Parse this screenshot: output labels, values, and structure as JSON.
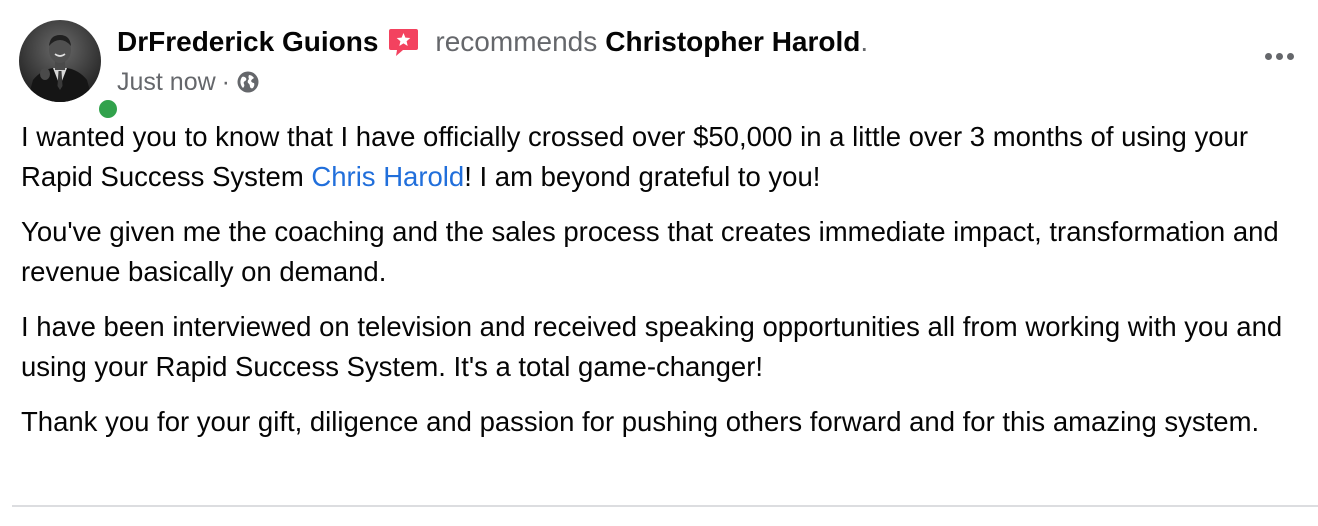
{
  "post": {
    "author": "DrFrederick Guions",
    "verb": "recommends",
    "target": "Christopher Harold",
    "period": ".",
    "timestamp": "Just now",
    "meta_separator": "·",
    "visibility_icon": "globe-icon",
    "recommend_icon": "recommend-badge-icon",
    "more_icon": "more-options-icon",
    "online": true,
    "paragraphs": [
      {
        "before": "I wanted you to know that I have officially crossed over $50,000 in a little over 3 months of using your Rapid Success System ",
        "mention": "Chris Harold",
        "after": "!  I am beyond grateful to you!"
      },
      {
        "text": "You've given me the coaching and the sales process that creates immediate impact, transformation and revenue basically on demand."
      },
      {
        "text": "I have been interviewed on television and received speaking opportunities all from working with you and using your Rapid Success System. It's a total game-changer!"
      },
      {
        "text": "Thank you for your gift, diligence and passion for pushing others forward and for this amazing system."
      }
    ]
  },
  "colors": {
    "primary_text": "#050505",
    "secondary_text": "#65676b",
    "link": "#216fdb",
    "online": "#31a24c",
    "recommend_badge": "#f3425f",
    "divider": "#dcdde0"
  }
}
